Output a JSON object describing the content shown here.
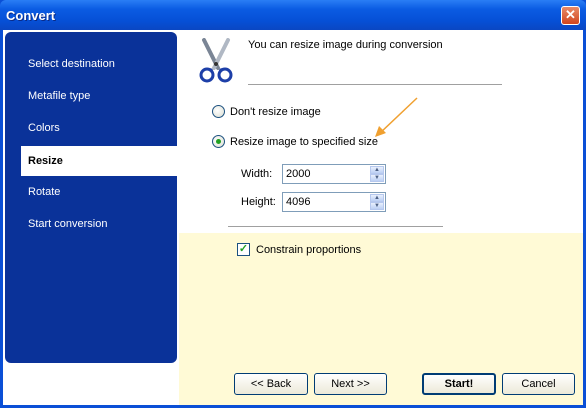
{
  "window": {
    "title": "Convert"
  },
  "sidebar": {
    "items": [
      {
        "label": "Select destination",
        "active": false
      },
      {
        "label": "Metafile type",
        "active": false
      },
      {
        "label": "Colors",
        "active": false
      },
      {
        "label": "Resize",
        "active": true
      },
      {
        "label": "Rotate",
        "active": false
      },
      {
        "label": "Start conversion",
        "active": false
      }
    ]
  },
  "main": {
    "intro_text": "You can resize image during conversion",
    "options": [
      {
        "label": "Don't resize image",
        "selected": false
      },
      {
        "label": "Resize image to specified size",
        "selected": true
      }
    ],
    "width": {
      "label": "Width:",
      "value": "2000"
    },
    "height": {
      "label": "Height:",
      "value": "4096"
    },
    "constrain": {
      "label": "Constrain proportions",
      "checked": true
    }
  },
  "buttons": {
    "back": "<< Back",
    "next": "Next >>",
    "start": "Start!",
    "cancel": "Cancel"
  },
  "icons": {
    "header": "scissors-icon",
    "close": "close-icon"
  },
  "colors": {
    "title_bar": "#0650d6",
    "sidebar": "#0a3299",
    "lower_panel": "#fffad6",
    "annotation_arrow": "#f0a030"
  }
}
